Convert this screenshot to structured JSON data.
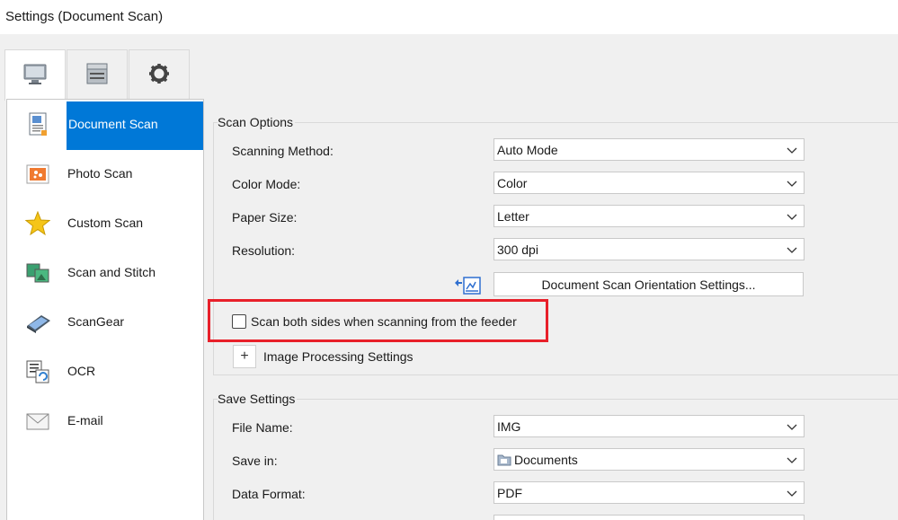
{
  "window": {
    "title": "Settings (Document Scan)"
  },
  "tabs": [
    {
      "icon": "monitor-icon",
      "active": true
    },
    {
      "icon": "scanner-icon",
      "active": false
    },
    {
      "icon": "gear-icon",
      "active": false
    }
  ],
  "sidebar": {
    "items": [
      {
        "label": "Document Scan",
        "icon": "document-scan-icon",
        "selected": true
      },
      {
        "label": "Photo Scan",
        "icon": "photo-scan-icon",
        "selected": false
      },
      {
        "label": "Custom Scan",
        "icon": "star-icon",
        "selected": false
      },
      {
        "label": "Scan and Stitch",
        "icon": "scan-stitch-icon",
        "selected": false
      },
      {
        "label": "ScanGear",
        "icon": "scangear-icon",
        "selected": false
      },
      {
        "label": "OCR",
        "icon": "ocr-icon",
        "selected": false
      },
      {
        "label": "E-mail",
        "icon": "envelope-icon",
        "selected": false
      }
    ]
  },
  "scan_options": {
    "title": "Scan Options",
    "scanning_method": {
      "label": "Scanning Method:",
      "value": "Auto Mode"
    },
    "color_mode": {
      "label": "Color Mode:",
      "value": "Color"
    },
    "paper_size": {
      "label": "Paper Size:",
      "value": "Letter"
    },
    "resolution": {
      "label": "Resolution:",
      "value": "300 dpi"
    },
    "orientation_button": "Document Scan Orientation Settings...",
    "duplex_checkbox": {
      "label": "Scan both sides when scanning from the feeder",
      "checked": false
    },
    "image_processing": {
      "expander": "+",
      "label": "Image Processing Settings"
    }
  },
  "save_settings": {
    "title": "Save Settings",
    "file_name": {
      "label": "File Name:",
      "value": "IMG"
    },
    "save_in": {
      "label": "Save in:",
      "value": "Documents",
      "icon": "folder-icon"
    },
    "data_format": {
      "label": "Data Format:",
      "value": "PDF"
    }
  },
  "colors": {
    "selection": "#0078d7",
    "highlight": "#e8202a"
  }
}
